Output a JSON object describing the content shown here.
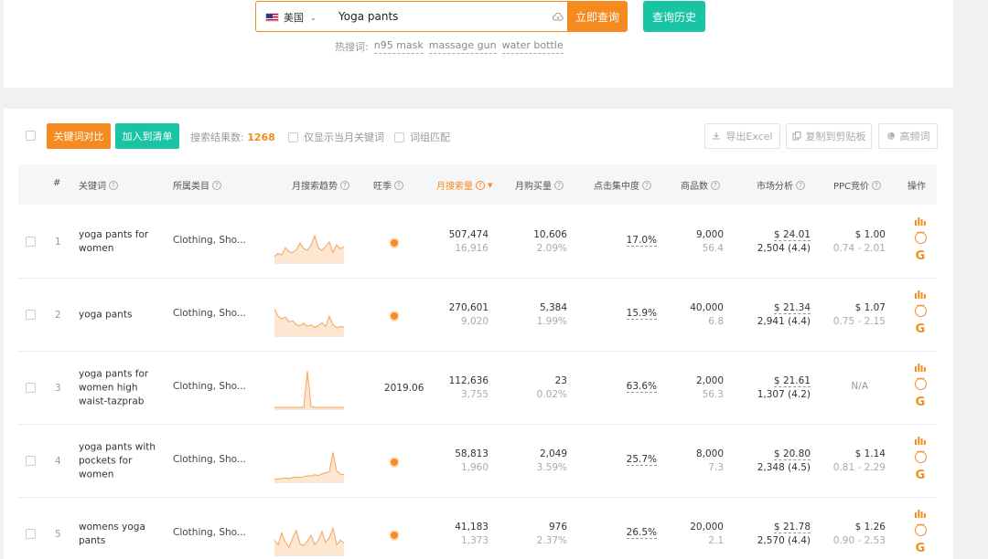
{
  "search": {
    "country": "美国",
    "query": "Yoga pants",
    "search_button": "立即查询",
    "history_button": "查询历史",
    "hot_label": "热搜词:",
    "hot_words": [
      "n95 mask",
      "massage gun",
      "water bottle"
    ]
  },
  "toolbar": {
    "compare_button": "关键词对比",
    "add_list_button": "加入到清单",
    "result_label": "搜索结果数:",
    "result_count": "1268",
    "option_current_month": "仅显示当月关键词",
    "option_phrase_match": "词组匹配",
    "export_button": "导出Excel",
    "copy_button": "复制到剪贴板",
    "freq_button": "高频词"
  },
  "columns": {
    "index": "#",
    "keyword": "关键词",
    "category": "所属类目",
    "trend": "月搜索趋势",
    "season": "旺季",
    "monthly_search": "月搜索量",
    "monthly_purchase": "月购买量",
    "click_concentration": "点击集中度",
    "product_count": "商品数",
    "market_analysis": "市场分析",
    "ppc_bid": "PPC竞价",
    "actions": "操作"
  },
  "rows": [
    {
      "index": "1",
      "keyword": "yoga pants for women",
      "category": "Clothing, Sho...",
      "season": "",
      "search_volume": "507,474",
      "search_sub": "16,916",
      "purchase": "10,606",
      "purchase_rate": "2.09%",
      "click": "17.0%",
      "goods": "9,000",
      "goods_sub": "56.4",
      "price": "$ 24.01",
      "reviews": "2,504 (4.4)",
      "ppc": "$ 1.00",
      "ppc_range": "0.74 - 2.01",
      "trend": [
        12,
        18,
        15,
        30,
        22,
        20,
        26,
        40,
        28,
        25,
        35,
        55,
        30,
        24,
        33,
        42,
        20,
        36,
        28,
        32
      ]
    },
    {
      "index": "2",
      "keyword": "yoga pants",
      "category": "Clothing, Sho...",
      "season": "",
      "search_volume": "270,601",
      "search_sub": "9,020",
      "purchase": "5,384",
      "purchase_rate": "1.99%",
      "click": "15.9%",
      "goods": "40,000",
      "goods_sub": "6.8",
      "price": "$ 21.34",
      "reviews": "2,941 (4.4)",
      "ppc": "$ 1.07",
      "ppc_range": "0.75 - 2.15",
      "trend": [
        55,
        40,
        34,
        38,
        28,
        30,
        22,
        20,
        25,
        18,
        22,
        16,
        20,
        26,
        18,
        40,
        22,
        16,
        18,
        17
      ]
    },
    {
      "index": "3",
      "keyword": "yoga pants for women high waist-tazprab",
      "category": "Clothing, Sho...",
      "season": "2019.06",
      "search_volume": "112,636",
      "search_sub": "3,755",
      "purchase": "23",
      "purchase_rate": "0.02%",
      "click": "63.6%",
      "goods": "2,000",
      "goods_sub": "56.3",
      "price": "$ 21.61",
      "reviews": "1,307 (4.2)",
      "ppc": "N/A",
      "ppc_range": "",
      "trend": [
        2,
        2,
        2,
        2,
        2,
        2,
        2,
        2,
        2,
        78,
        4,
        2,
        2,
        2,
        2,
        2,
        2,
        2,
        2,
        2
      ]
    },
    {
      "index": "4",
      "keyword": "yoga pants with pockets for women",
      "category": "Clothing, Sho...",
      "season": "",
      "search_volume": "58,813",
      "search_sub": "1,960",
      "purchase": "2,049",
      "purchase_rate": "3.59%",
      "click": "25.7%",
      "goods": "8,000",
      "goods_sub": "7.3",
      "price": "$ 20.80",
      "reviews": "2,348 (4.5)",
      "ppc": "$ 1.14",
      "ppc_range": "0.81 - 2.29",
      "trend": [
        4,
        5,
        6,
        7,
        6,
        8,
        9,
        8,
        10,
        12,
        11,
        14,
        12,
        16,
        18,
        20,
        60,
        22,
        15,
        14
      ]
    },
    {
      "index": "5",
      "keyword": "womens yoga pants",
      "category": "Clothing, Sho...",
      "season": "",
      "search_volume": "41,183",
      "search_sub": "1,373",
      "purchase": "976",
      "purchase_rate": "2.37%",
      "click": "26.5%",
      "goods": "20,000",
      "goods_sub": "2.1",
      "price": "$ 21.78",
      "reviews": "2,570 (4.4)",
      "ppc": "$ 1.26",
      "ppc_range": "0.90 - 2.53",
      "trend": [
        30,
        20,
        45,
        25,
        15,
        35,
        50,
        22,
        18,
        28,
        40,
        20,
        30,
        48,
        25,
        35,
        55,
        20,
        30,
        24
      ]
    }
  ]
}
